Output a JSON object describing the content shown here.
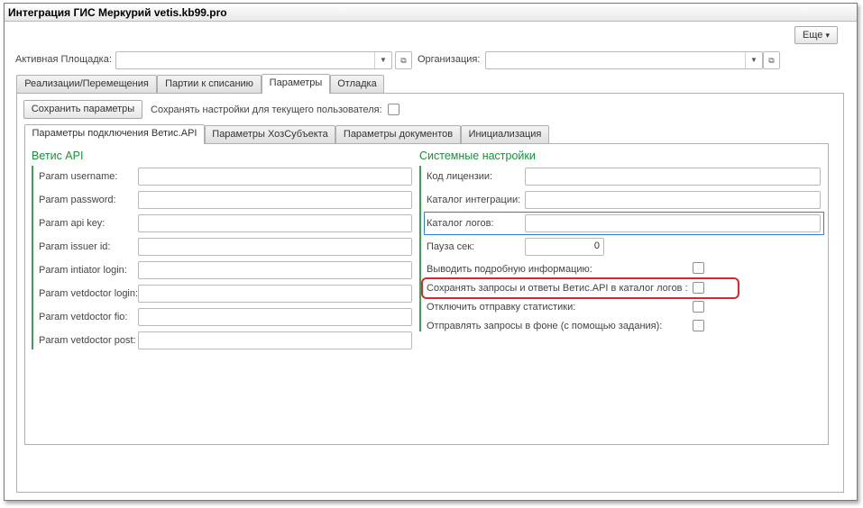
{
  "window": {
    "title": "Интеграция ГИС Меркурий vetis.kb99.pro"
  },
  "toolbar": {
    "more_label": "Еще",
    "more_arrow": "▾"
  },
  "header": {
    "site_label": "Активная Площадка:",
    "site_value": "",
    "org_label": "Организация:",
    "org_value": ""
  },
  "main_tabs": [
    {
      "label": "Реализации/Перемещения"
    },
    {
      "label": "Партии к списанию"
    },
    {
      "label": "Параметры",
      "active": true
    },
    {
      "label": "Отладка"
    }
  ],
  "params": {
    "save_button": "Сохранить параметры",
    "save_for_user_label": "Сохранять настройки для текущего пользователя:",
    "save_for_user_checked": false
  },
  "sub_tabs": [
    {
      "label": "Параметры подключения Ветис.API",
      "active": true
    },
    {
      "label": "Параметры ХозСубъекта"
    },
    {
      "label": "Параметры документов"
    },
    {
      "label": "Инициализация"
    }
  ],
  "vetis_api": {
    "title": "Ветис API",
    "fields": [
      {
        "label": "Param username:",
        "value": ""
      },
      {
        "label": "Param password:",
        "value": ""
      },
      {
        "label": "Param api key:",
        "value": ""
      },
      {
        "label": "Param issuer id:",
        "value": ""
      },
      {
        "label": "Param intiator login:",
        "value": ""
      },
      {
        "label": "Param vetdoctor login:",
        "value": ""
      },
      {
        "label": "Param vetdoctor fio:",
        "value": ""
      },
      {
        "label": "Param vetdoctor post:",
        "value": ""
      }
    ]
  },
  "system": {
    "title": "Системные настройки",
    "license_label": "Код лицензии:",
    "license_value": "",
    "integration_dir_label": "Каталог интеграции:",
    "integration_dir_value": "",
    "log_dir_label": "Каталог логов:",
    "log_dir_value": "",
    "pause_label": "Пауза сек:",
    "pause_value": "0",
    "verbose_label": "Выводить подробную информацию:",
    "save_requests_label": "Сохранять запросы и ответы Ветис.API в каталог логов :",
    "disable_stats_label": "Отключить отправку статистики:",
    "background_label": "Отправлять запросы в фоне (с помощью задания):"
  },
  "colors": {
    "accent_green": "#1a8f3c",
    "focus_blue": "#2a7fd4",
    "highlight_red": "#d9272e"
  }
}
